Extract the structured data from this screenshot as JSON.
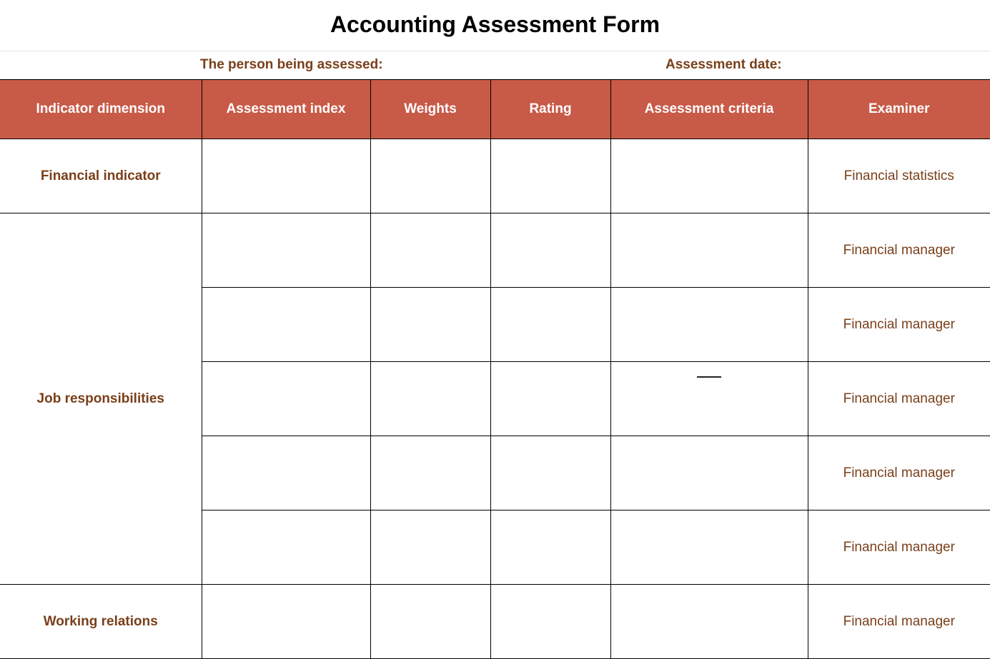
{
  "title": "Accounting Assessment Form",
  "meta": {
    "person_label": "The person being assessed:",
    "date_label": "Assessment date:"
  },
  "columns": {
    "dimension": "Indicator dimension",
    "index": "Assessment index",
    "weights": "Weights",
    "rating": "Rating",
    "criteria": "Assessment criteria",
    "examiner": "Examiner"
  },
  "groups": [
    {
      "dimension": "Financial indicator",
      "rows": [
        {
          "index": "",
          "weights": "",
          "rating": "",
          "criteria": "",
          "examiner": "Financial statistics"
        }
      ]
    },
    {
      "dimension": "Job responsibilities",
      "rows": [
        {
          "index": "",
          "weights": "",
          "rating": "",
          "criteria": "",
          "examiner": "Financial manager"
        },
        {
          "index": "",
          "weights": "",
          "rating": "",
          "criteria": "",
          "examiner": "Financial manager"
        },
        {
          "index": "",
          "weights": "",
          "rating": "",
          "criteria": "",
          "criteria_has_mark": true,
          "examiner": "Financial manager"
        },
        {
          "index": "",
          "weights": "",
          "rating": "",
          "criteria": "",
          "examiner": "Financial manager"
        },
        {
          "index": "",
          "weights": "",
          "rating": "",
          "criteria": "",
          "examiner": "Financial manager"
        }
      ]
    },
    {
      "dimension": "Working relations",
      "rows": [
        {
          "index": "",
          "weights": "",
          "rating": "",
          "criteria": "",
          "examiner": "Financial manager"
        }
      ]
    }
  ]
}
